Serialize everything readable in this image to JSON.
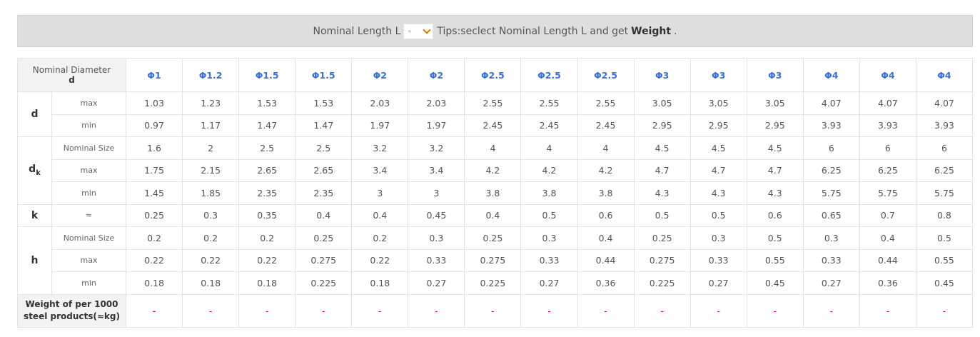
{
  "header": {
    "length_label": "Nominal Length L",
    "select_value": "-",
    "tip_text": "Tips:seclect Nominal Length L and get",
    "tip_bold": "Weight",
    "tip_end": "."
  },
  "table": {
    "corner_line1": "Nominal Diameter",
    "corner_line2": "d",
    "diameters": [
      "Φ1",
      "Φ1.2",
      "Φ1.5",
      "Φ1.5",
      "Φ2",
      "Φ2",
      "Φ2.5",
      "Φ2.5",
      "Φ2.5",
      "Φ3",
      "Φ3",
      "Φ3",
      "Φ4",
      "Φ4",
      "Φ4"
    ],
    "groups": [
      {
        "label": "d",
        "sub": "",
        "rows": [
          {
            "name": "max",
            "values": [
              "1.03",
              "1.23",
              "1.53",
              "1.53",
              "2.03",
              "2.03",
              "2.55",
              "2.55",
              "2.55",
              "3.05",
              "3.05",
              "3.05",
              "4.07",
              "4.07",
              "4.07"
            ]
          },
          {
            "name": "min",
            "values": [
              "0.97",
              "1.17",
              "1.47",
              "1.47",
              "1.97",
              "1.97",
              "2.45",
              "2.45",
              "2.45",
              "2.95",
              "2.95",
              "2.95",
              "3.93",
              "3.93",
              "3.93"
            ]
          }
        ]
      },
      {
        "label": "d",
        "sub": "k",
        "rows": [
          {
            "name": "Nominal Size",
            "values": [
              "1.6",
              "2",
              "2.5",
              "2.5",
              "3.2",
              "3.2",
              "4",
              "4",
              "4",
              "4.5",
              "4.5",
              "4.5",
              "6",
              "6",
              "6"
            ]
          },
          {
            "name": "max",
            "values": [
              "1.75",
              "2.15",
              "2.65",
              "2.65",
              "3.4",
              "3.4",
              "4.2",
              "4.2",
              "4.2",
              "4.7",
              "4.7",
              "4.7",
              "6.25",
              "6.25",
              "6.25"
            ]
          },
          {
            "name": "min",
            "values": [
              "1.45",
              "1.85",
              "2.35",
              "2.35",
              "3",
              "3",
              "3.8",
              "3.8",
              "3.8",
              "4.3",
              "4.3",
              "4.3",
              "5.75",
              "5.75",
              "5.75"
            ]
          }
        ]
      },
      {
        "label": "k",
        "sub": "",
        "rows": [
          {
            "name": "≈",
            "values": [
              "0.25",
              "0.3",
              "0.35",
              "0.4",
              "0.4",
              "0.45",
              "0.4",
              "0.5",
              "0.6",
              "0.5",
              "0.5",
              "0.6",
              "0.65",
              "0.7",
              "0.8"
            ]
          }
        ]
      },
      {
        "label": "h",
        "sub": "",
        "rows": [
          {
            "name": "Nominal Size",
            "values": [
              "0.2",
              "0.2",
              "0.2",
              "0.25",
              "0.2",
              "0.3",
              "0.25",
              "0.3",
              "0.4",
              "0.25",
              "0.3",
              "0.5",
              "0.3",
              "0.4",
              "0.5"
            ]
          },
          {
            "name": "max",
            "values": [
              "0.22",
              "0.22",
              "0.22",
              "0.275",
              "0.22",
              "0.33",
              "0.275",
              "0.33",
              "0.44",
              "0.275",
              "0.33",
              "0.55",
              "0.33",
              "0.44",
              "0.55"
            ]
          },
          {
            "name": "min",
            "values": [
              "0.18",
              "0.18",
              "0.18",
              "0.225",
              "0.18",
              "0.27",
              "0.225",
              "0.27",
              "0.36",
              "0.225",
              "0.27",
              "0.45",
              "0.27",
              "0.36",
              "0.45"
            ]
          }
        ]
      }
    ],
    "weight_label_line1": "Weight of per 1000",
    "weight_label_line2": "steel products(≈kg)",
    "weight_values": [
      "-",
      "-",
      "-",
      "-",
      "-",
      "-",
      "-",
      "-",
      "-",
      "-",
      "-",
      "-",
      "-",
      "-",
      "-"
    ]
  },
  "colors": {
    "accent": "#3a6fd8",
    "dash": "#d0021b",
    "select_text": "#e07a00",
    "header_bg": "#dedede"
  },
  "icons": {
    "select_arrow": "chevron-down-icon"
  }
}
